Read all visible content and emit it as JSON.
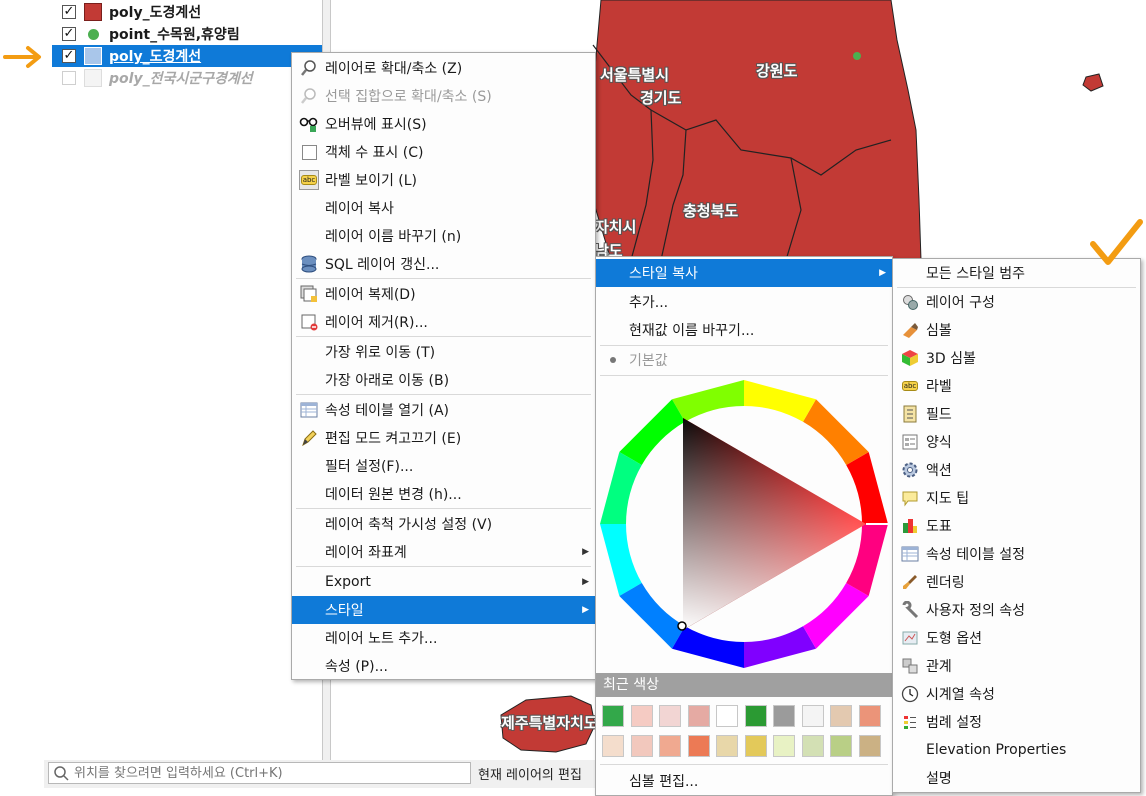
{
  "layers": [
    {
      "label": "poly_도경계선",
      "checked": true,
      "symbol": "fill-square",
      "color": "#c23a35",
      "state": "normal"
    },
    {
      "label": "point_수목원,휴양림",
      "checked": true,
      "symbol": "point-circle",
      "color": "#4caf50",
      "state": "normal"
    },
    {
      "label": "poly_도경계선",
      "checked": true,
      "symbol": "fill-square",
      "color": "#a9c6ea",
      "state": "selected"
    },
    {
      "label": "poly_전국시군구경계선",
      "checked": false,
      "symbol": "fill-square",
      "color": "#dddddd",
      "state": "disabled"
    }
  ],
  "map": {
    "fill_color": "#c23a35",
    "labels": [
      "서울특별시",
      "경기도",
      "강원도",
      "충청북도",
      "자치시",
      "남도",
      "제주특별자치도"
    ]
  },
  "search": {
    "placeholder": "위치를 찾으려면 입력하세요 (Ctrl+K)"
  },
  "status": {
    "edit_label": "현재 레이어의 편집"
  },
  "context_menu": {
    "items": [
      {
        "label": "레이어로 확대/축소 (Z)",
        "icon": "zoom-to-layer-icon"
      },
      {
        "label": "선택 집합으로 확대/축소 (S)",
        "icon": "zoom-to-selection-icon",
        "disabled": true
      },
      {
        "label": "오버뷰에 표시(S)",
        "icon": "overview-icon"
      },
      {
        "label": "객체 수 표시 (C)",
        "icon": "checkbox-icon"
      },
      {
        "label": "라벨 보이기 (L)",
        "icon": "label-icon"
      },
      {
        "label": "레이어 복사",
        "icon": ""
      },
      {
        "label": "레이어 이름 바꾸기 (n)",
        "icon": ""
      },
      {
        "label": "SQL 레이어 갱신...",
        "icon": "database-icon"
      },
      {
        "label": "레이어 복제(D)",
        "icon": "duplicate-layer-icon"
      },
      {
        "label": "레이어 제거(R)...",
        "icon": "remove-layer-icon"
      },
      {
        "label": "가장 위로 이동 (T)",
        "icon": ""
      },
      {
        "label": "가장 아래로 이동 (B)",
        "icon": ""
      },
      {
        "label": "속성 테이블 열기 (A)",
        "icon": "table-icon"
      },
      {
        "label": "편집 모드 켜고끄기 (E)",
        "icon": "pencil-icon"
      },
      {
        "label": "필터 설정(F)...",
        "icon": ""
      },
      {
        "label": "데이터 원본 변경 (h)...",
        "icon": ""
      },
      {
        "label": "레이어 축척 가시성 설정 (V)",
        "icon": ""
      },
      {
        "label": "레이어 좌표계",
        "icon": "",
        "submenu": true
      },
      {
        "label": "Export",
        "icon": "",
        "submenu": true
      },
      {
        "label": "스타일",
        "icon": "",
        "submenu": true,
        "highlighted": true
      },
      {
        "label": "레이어 노트 추가...",
        "icon": ""
      },
      {
        "label": "속성 (P)...",
        "icon": ""
      }
    ]
  },
  "style_menu": {
    "copy_style": "스타일 복사",
    "add": "추가...",
    "rename": "현재값 이름 바꾸기...",
    "default": "기본값",
    "recent_colors_label": "최근 색상",
    "recent_colors": [
      "#33a84a",
      "#f5cbc3",
      "#f2d5d3",
      "#e5aaa3",
      "#ffffff",
      "#2b9a33",
      "#9b9b9b",
      "#f4f4f4",
      "#e3c9b0",
      "#eb9479",
      "#f4ddcc",
      "#f2c8bd",
      "#f0a990",
      "#ec7a55",
      "#e8d7a9",
      "#e3c95a",
      "#e8f2c4",
      "#d3e0b4",
      "#b9cf86",
      "#cbb184"
    ],
    "edit_symbol": "심볼 편집..."
  },
  "copy_style_menu": {
    "items": [
      {
        "label": "모든 스타일 범주",
        "icon": ""
      },
      {
        "label": "레이어 구성",
        "icon": "layer-config-icon"
      },
      {
        "label": "심볼",
        "icon": "symbology-icon"
      },
      {
        "label": "3D 심볼",
        "icon": "cube-icon"
      },
      {
        "label": "라벨",
        "icon": "label-icon"
      },
      {
        "label": "필드",
        "icon": "fields-icon"
      },
      {
        "label": "양식",
        "icon": "form-icon"
      },
      {
        "label": "액션",
        "icon": "action-gear-icon"
      },
      {
        "label": "지도 팁",
        "icon": "map-tip-icon"
      },
      {
        "label": "도표",
        "icon": "diagram-icon"
      },
      {
        "label": "속성 테이블 설정",
        "icon": "table-icon"
      },
      {
        "label": "렌더링",
        "icon": "brush-icon"
      },
      {
        "label": "사용자 정의 속성",
        "icon": "wrench-icon"
      },
      {
        "label": "도형 옵션",
        "icon": "geometry-icon"
      },
      {
        "label": "관계",
        "icon": "relations-icon"
      },
      {
        "label": "시계열 속성",
        "icon": "clock-icon"
      },
      {
        "label": "범례 설정",
        "icon": "legend-icon"
      },
      {
        "label": "Elevation Properties",
        "icon": ""
      },
      {
        "label": "설명",
        "icon": ""
      }
    ]
  },
  "annotations": {
    "arrow_color": "#f39c12",
    "check_color": "#f39c12"
  }
}
